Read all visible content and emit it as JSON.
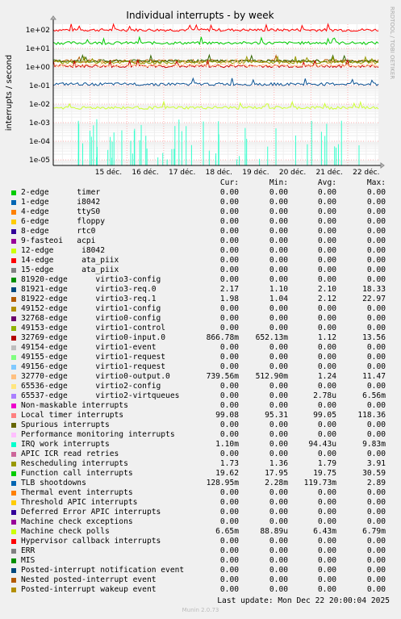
{
  "chart_data": {
    "type": "line",
    "title": "Individual interrupts - by week",
    "ylabel": "interrupts / second",
    "yscale": "log",
    "ylim": [
      5e-06,
      200
    ],
    "yticks": [
      "1e+02",
      "1e+01",
      "1e+00",
      "1e-01",
      "1e-02",
      "1e-03",
      "1e-04",
      "1e-05"
    ],
    "xlim": [
      "2025-12-14",
      "2025-12-22 20:00"
    ],
    "xticks": [
      "15 déc.",
      "16 déc.",
      "17 déc.",
      "18 déc.",
      "19 déc.",
      "20 déc.",
      "21 déc.",
      "22 déc."
    ],
    "grid": true,
    "side_text": "RRDTOOL / TOBI OETIKER",
    "visible_series": [
      {
        "name": "Local timer interrupts",
        "color": "#ff0000",
        "level": 99.08
      },
      {
        "name": "Function call interrupts",
        "color": "#00cc00",
        "level": 19.75
      },
      {
        "name": "virtio3-req.1",
        "color": "#b35a00",
        "level": 2.12
      },
      {
        "name": "virtio3-req.0",
        "color": "#336600",
        "level": 2.1
      },
      {
        "name": "Rescheduling interrupts",
        "color": "#999900",
        "level": 1.79
      },
      {
        "name": "virtio0-input.0",
        "color": "#cc0000",
        "level": 1.12
      },
      {
        "name": "virtio0-output.0",
        "color": "#ffcc99",
        "level": 1.24
      },
      {
        "name": "TLB shootdowns",
        "color": "#0b5394",
        "level": 0.11973
      },
      {
        "name": "Machine check polls",
        "color": "#ccff33",
        "level": 0.00643
      },
      {
        "name": "IRQ work interrupts",
        "color": "#33ffcc",
        "level": 9.443e-05
      }
    ]
  },
  "legend": {
    "headers": [
      "Cur:",
      "Min:",
      "Avg:",
      "Max:"
    ],
    "rows": [
      {
        "name": "2-edge      timer",
        "color": "#00cc00",
        "cur": "0.00",
        "min": "0.00",
        "avg": "0.00",
        "max": "0.00"
      },
      {
        "name": "1-edge      i8042",
        "color": "#0066b3",
        "cur": "0.00",
        "min": "0.00",
        "avg": "0.00",
        "max": "0.00"
      },
      {
        "name": "4-edge      ttyS0",
        "color": "#ff8000",
        "cur": "0.00",
        "min": "0.00",
        "avg": "0.00",
        "max": "0.00"
      },
      {
        "name": "6-edge      floppy",
        "color": "#ffcc00",
        "cur": "0.00",
        "min": "0.00",
        "avg": "0.00",
        "max": "0.00"
      },
      {
        "name": "8-edge      rtc0",
        "color": "#330099",
        "cur": "0.00",
        "min": "0.00",
        "avg": "0.00",
        "max": "0.00"
      },
      {
        "name": "9-fasteoi   acpi",
        "color": "#990099",
        "cur": "0.00",
        "min": "0.00",
        "avg": "0.00",
        "max": "0.00"
      },
      {
        "name": "12-edge      i8042",
        "color": "#ccff00",
        "cur": "0.00",
        "min": "0.00",
        "avg": "0.00",
        "max": "0.00"
      },
      {
        "name": "14-edge      ata_piix",
        "color": "#ff0000",
        "cur": "0.00",
        "min": "0.00",
        "avg": "0.00",
        "max": "0.00"
      },
      {
        "name": "15-edge      ata_piix",
        "color": "#808080",
        "cur": "0.00",
        "min": "0.00",
        "avg": "0.00",
        "max": "0.00"
      },
      {
        "name": "81920-edge      virtio3-config",
        "color": "#008f00",
        "cur": "0.00",
        "min": "0.00",
        "avg": "0.00",
        "max": "0.00"
      },
      {
        "name": "81921-edge      virtio3-req.0",
        "color": "#00487d",
        "cur": "2.17",
        "min": "1.10",
        "avg": "2.10",
        "max": "18.33"
      },
      {
        "name": "81922-edge      virtio3-req.1",
        "color": "#b35a00",
        "cur": "1.98",
        "min": "1.04",
        "avg": "2.12",
        "max": "22.97"
      },
      {
        "name": "49152-edge      virtio1-config",
        "color": "#b38f00",
        "cur": "0.00",
        "min": "0.00",
        "avg": "0.00",
        "max": "0.00"
      },
      {
        "name": "32768-edge      virtio0-config",
        "color": "#6b006b",
        "cur": "0.00",
        "min": "0.00",
        "avg": "0.00",
        "max": "0.00"
      },
      {
        "name": "49153-edge      virtio1-control",
        "color": "#8fb300",
        "cur": "0.00",
        "min": "0.00",
        "avg": "0.00",
        "max": "0.00"
      },
      {
        "name": "32769-edge      virtio0-input.0",
        "color": "#b30000",
        "cur": "866.78m",
        "min": "652.13m",
        "avg": "1.12",
        "max": "13.56"
      },
      {
        "name": "49154-edge      virtio1-event",
        "color": "#bebebe",
        "cur": "0.00",
        "min": "0.00",
        "avg": "0.00",
        "max": "0.00"
      },
      {
        "name": "49155-edge      virtio1-request",
        "color": "#80ff80",
        "cur": "0.00",
        "min": "0.00",
        "avg": "0.00",
        "max": "0.00"
      },
      {
        "name": "49156-edge      virtio1-request",
        "color": "#80c9ff",
        "cur": "0.00",
        "min": "0.00",
        "avg": "0.00",
        "max": "0.00"
      },
      {
        "name": "32770-edge      virtio0-output.0",
        "color": "#ffc080",
        "cur": "739.56m",
        "min": "512.90m",
        "avg": "1.24",
        "max": "11.47"
      },
      {
        "name": "65536-edge      virtio2-config",
        "color": "#ffe680",
        "cur": "0.00",
        "min": "0.00",
        "avg": "0.00",
        "max": "0.00"
      },
      {
        "name": "65537-edge      virtio2-virtqueues",
        "color": "#aa80ff",
        "cur": "0.00",
        "min": "0.00",
        "avg": "2.78u",
        "max": "6.56m"
      },
      {
        "name": "Non-maskable interrupts",
        "color": "#ee00cc",
        "cur": "0.00",
        "min": "0.00",
        "avg": "0.00",
        "max": "0.00"
      },
      {
        "name": "Local timer interrupts",
        "color": "#ff8080",
        "cur": "99.08",
        "min": "95.31",
        "avg": "99.05",
        "max": "118.36"
      },
      {
        "name": "Spurious interrupts",
        "color": "#666600",
        "cur": "0.00",
        "min": "0.00",
        "avg": "0.00",
        "max": "0.00"
      },
      {
        "name": "Performance monitoring interrupts",
        "color": "#ffbfff",
        "cur": "0.00",
        "min": "0.00",
        "avg": "0.00",
        "max": "0.00"
      },
      {
        "name": "IRQ work interrupts",
        "color": "#00ffcc",
        "cur": "1.10m",
        "min": "0.00",
        "avg": "94.43u",
        "max": "9.83m"
      },
      {
        "name": "APIC ICR read retries",
        "color": "#cc6699",
        "cur": "0.00",
        "min": "0.00",
        "avg": "0.00",
        "max": "0.00"
      },
      {
        "name": "Rescheduling interrupts",
        "color": "#999900",
        "cur": "1.73",
        "min": "1.36",
        "avg": "1.79",
        "max": "3.91"
      },
      {
        "name": "Function call interrupts",
        "color": "#00cc00",
        "cur": "19.62",
        "min": "17.95",
        "avg": "19.75",
        "max": "30.59"
      },
      {
        "name": "TLB shootdowns",
        "color": "#0066b3",
        "cur": "128.95m",
        "min": "2.28m",
        "avg": "119.73m",
        "max": "2.89"
      },
      {
        "name": "Thermal event interrupts",
        "color": "#ff8000",
        "cur": "0.00",
        "min": "0.00",
        "avg": "0.00",
        "max": "0.00"
      },
      {
        "name": "Threshold APIC interrupts",
        "color": "#ffcc00",
        "cur": "0.00",
        "min": "0.00",
        "avg": "0.00",
        "max": "0.00"
      },
      {
        "name": "Deferred Error APIC interrupts",
        "color": "#330099",
        "cur": "0.00",
        "min": "0.00",
        "avg": "0.00",
        "max": "0.00"
      },
      {
        "name": "Machine check exceptions",
        "color": "#990099",
        "cur": "0.00",
        "min": "0.00",
        "avg": "0.00",
        "max": "0.00"
      },
      {
        "name": "Machine check polls",
        "color": "#ccff00",
        "cur": "6.65m",
        "min": "88.89u",
        "avg": "6.43m",
        "max": "6.79m"
      },
      {
        "name": "Hypervisor callback interrupts",
        "color": "#ff0000",
        "cur": "0.00",
        "min": "0.00",
        "avg": "0.00",
        "max": "0.00"
      },
      {
        "name": "ERR",
        "color": "#808080",
        "cur": "0.00",
        "min": "0.00",
        "avg": "0.00",
        "max": "0.00"
      },
      {
        "name": "MIS",
        "color": "#008f00",
        "cur": "0.00",
        "min": "0.00",
        "avg": "0.00",
        "max": "0.00"
      },
      {
        "name": "Posted-interrupt notification event",
        "color": "#00487d",
        "cur": "0.00",
        "min": "0.00",
        "avg": "0.00",
        "max": "0.00"
      },
      {
        "name": "Nested posted-interrupt event",
        "color": "#b35a00",
        "cur": "0.00",
        "min": "0.00",
        "avg": "0.00",
        "max": "0.00"
      },
      {
        "name": "Posted-interrupt wakeup event",
        "color": "#b38f00",
        "cur": "0.00",
        "min": "0.00",
        "avg": "0.00",
        "max": "0.00"
      }
    ]
  },
  "last_update": "Last update: Mon Dec 22 20:00:04 2025",
  "footer": "Munin 2.0.73"
}
